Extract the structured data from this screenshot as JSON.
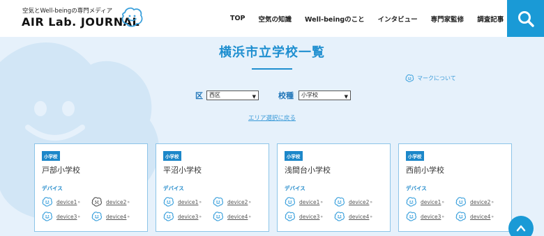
{
  "header": {
    "tagline": "空気とWell-beingの専門メディア",
    "logo": "AIR Lab. JOURNAL",
    "nav": [
      "TOP",
      "空気の知識",
      "Well-beingのこと",
      "インタビュー",
      "専門家監修",
      "調査記事"
    ]
  },
  "main": {
    "title": "横浜市立学校一覧",
    "mark_link": "マークについて",
    "filters": {
      "ward_label": "区",
      "ward_value": "西区",
      "type_label": "校種",
      "type_value": "小学校"
    },
    "back_link": "エリア選択に戻る"
  },
  "cards": [
    {
      "badge": "小学校",
      "name": "戸部小学校",
      "devices_label": "デバイス",
      "devices": [
        "device1",
        "device2",
        "device3",
        "device4"
      ]
    },
    {
      "badge": "小学校",
      "name": "平沼小学校",
      "devices_label": "デバイス",
      "devices": [
        "device1",
        "device2",
        "device3",
        "device4"
      ]
    },
    {
      "badge": "小学校",
      "name": "浅間台小学校",
      "devices_label": "デバイス",
      "devices": [
        "device1",
        "device2",
        "device3",
        "device4"
      ]
    },
    {
      "badge": "小学校",
      "name": "西前小学校",
      "devices_label": "デバイス",
      "devices": [
        "device1",
        "device2",
        "device3",
        "device4"
      ]
    }
  ],
  "icons": {
    "search": "search-icon",
    "scroll_top": "chevron-up-icon",
    "device_happy": "smile-face-icon",
    "device_alert": "frown-face-icon"
  },
  "colors": {
    "accent": "#1a9ad6",
    "heading": "#1f8fd0",
    "badge": "#1c87c9",
    "background": "#e6f1fb"
  }
}
